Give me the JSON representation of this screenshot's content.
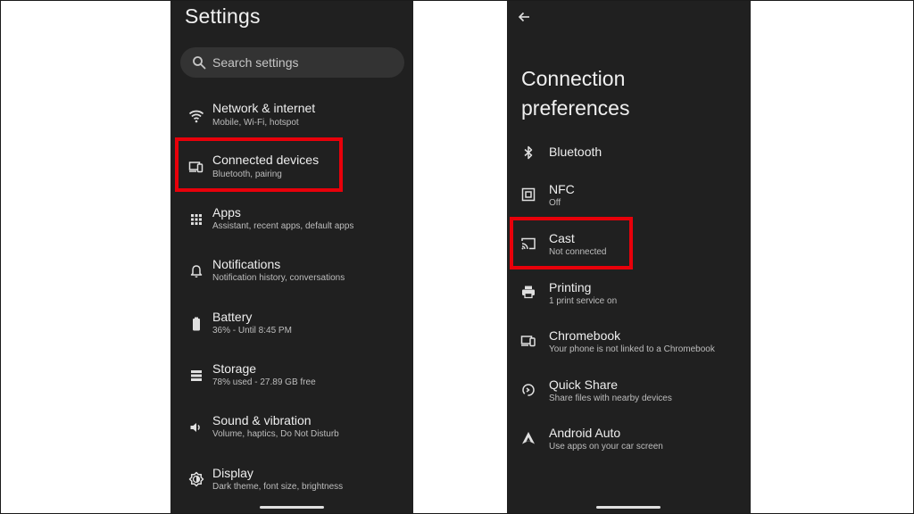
{
  "left_screen": {
    "title": "Settings",
    "search": {
      "placeholder": "Search settings",
      "icon": "search-icon"
    },
    "items": [
      {
        "title": "Network & internet",
        "subtitle": "Mobile, Wi-Fi, hotspot",
        "icon": "wifi-icon"
      },
      {
        "title": "Connected devices",
        "subtitle": "Bluetooth, pairing",
        "icon": "connected-devices-icon",
        "highlighted": true
      },
      {
        "title": "Apps",
        "subtitle": "Assistant, recent apps, default apps",
        "icon": "apps-grid-icon"
      },
      {
        "title": "Notifications",
        "subtitle": "Notification history, conversations",
        "icon": "bell-icon"
      },
      {
        "title": "Battery",
        "subtitle": "36% - Until 8:45 PM",
        "icon": "battery-icon"
      },
      {
        "title": "Storage",
        "subtitle": "78% used - 27.89 GB free",
        "icon": "storage-icon"
      },
      {
        "title": "Sound & vibration",
        "subtitle": "Volume, haptics, Do Not Disturb",
        "icon": "volume-icon"
      },
      {
        "title": "Display",
        "subtitle": "Dark theme, font size, brightness",
        "icon": "brightness-icon"
      }
    ]
  },
  "right_screen": {
    "back_icon": "back-arrow-icon",
    "title": "Connection preferences",
    "items": [
      {
        "title": "Bluetooth",
        "subtitle": "",
        "icon": "bluetooth-icon"
      },
      {
        "title": "NFC",
        "subtitle": "Off",
        "icon": "nfc-icon"
      },
      {
        "title": "Cast",
        "subtitle": "Not connected",
        "icon": "cast-icon",
        "highlighted": true
      },
      {
        "title": "Printing",
        "subtitle": "1 print service on",
        "icon": "printer-icon"
      },
      {
        "title": "Chromebook",
        "subtitle": "Your phone is not linked to a Chromebook",
        "icon": "chromebook-icon"
      },
      {
        "title": "Quick Share",
        "subtitle": "Share files with nearby devices",
        "icon": "quick-share-icon"
      },
      {
        "title": "Android Auto",
        "subtitle": "Use apps on your car screen",
        "icon": "android-auto-icon"
      }
    ]
  },
  "colors": {
    "page_background": "#ffffff",
    "phone_background": "#202020",
    "search_background": "#333333",
    "highlight": "#e8000a",
    "primary_text": "#eeeeee",
    "secondary_text": "#bdbdbd"
  }
}
